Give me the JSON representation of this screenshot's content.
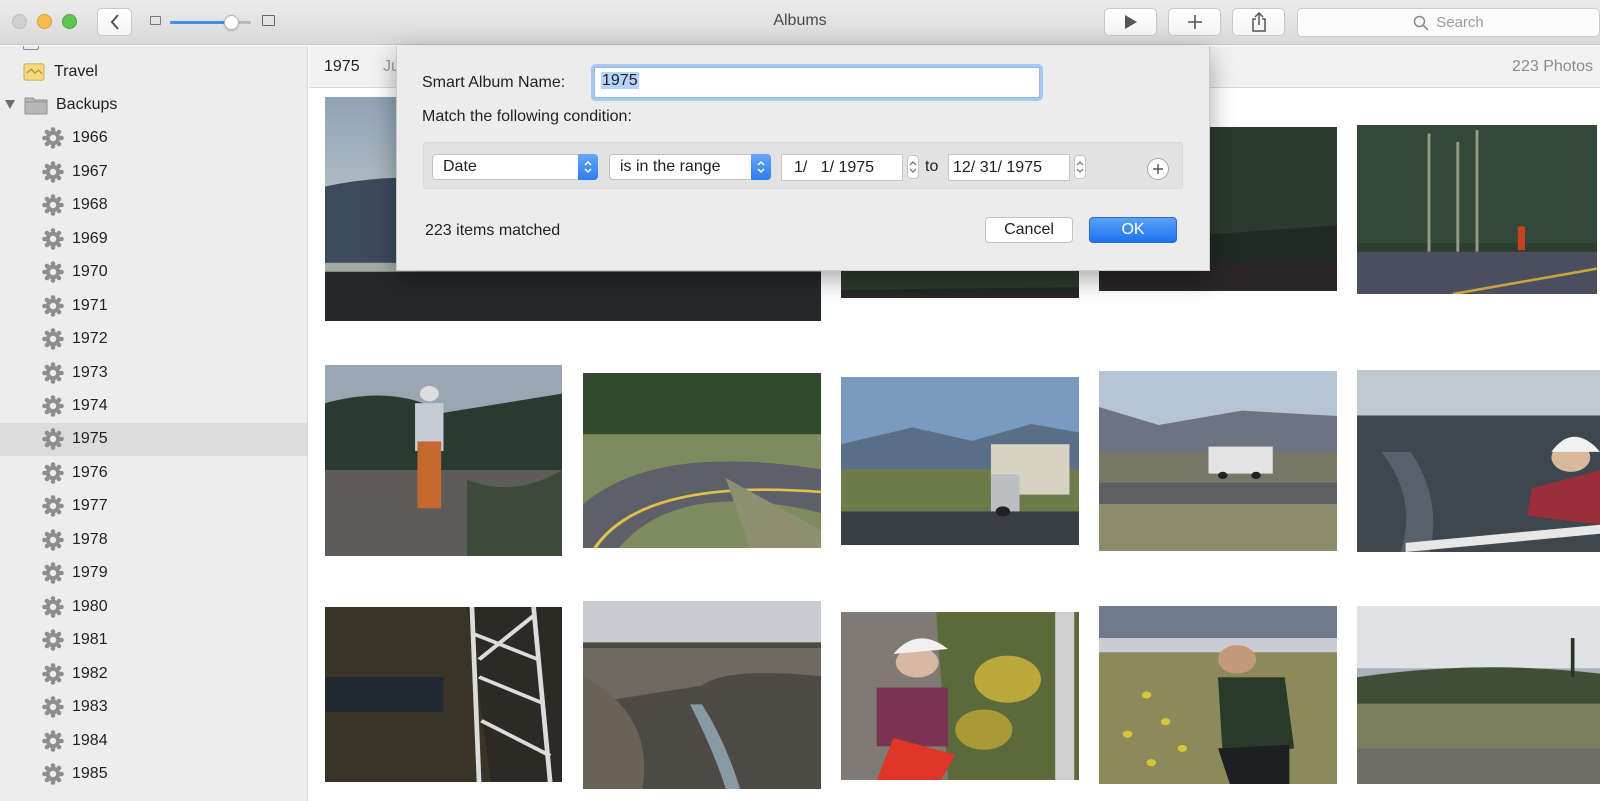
{
  "window": {
    "title": "Albums"
  },
  "toolbar": {
    "search_placeholder": "Search",
    "zoom_level": 0.75
  },
  "sidebar": {
    "items": [
      {
        "label": "Travel",
        "type": "album"
      },
      {
        "label": "Backups",
        "type": "folder"
      },
      {
        "label": "1966",
        "type": "smart"
      },
      {
        "label": "1967",
        "type": "smart"
      },
      {
        "label": "1968",
        "type": "smart"
      },
      {
        "label": "1969",
        "type": "smart"
      },
      {
        "label": "1970",
        "type": "smart"
      },
      {
        "label": "1971",
        "type": "smart"
      },
      {
        "label": "1972",
        "type": "smart"
      },
      {
        "label": "1973",
        "type": "smart"
      },
      {
        "label": "1974",
        "type": "smart"
      },
      {
        "label": "1975",
        "type": "smart",
        "selected": true
      },
      {
        "label": "1976",
        "type": "smart"
      },
      {
        "label": "1977",
        "type": "smart"
      },
      {
        "label": "1978",
        "type": "smart"
      },
      {
        "label": "1979",
        "type": "smart"
      },
      {
        "label": "1980",
        "type": "smart"
      },
      {
        "label": "1981",
        "type": "smart"
      },
      {
        "label": "1982",
        "type": "smart"
      },
      {
        "label": "1983",
        "type": "smart"
      },
      {
        "label": "1984",
        "type": "smart"
      },
      {
        "label": "1985",
        "type": "smart"
      }
    ]
  },
  "content": {
    "title": "1975",
    "subtitle": "Ju",
    "count": "223 Photos"
  },
  "photos": [
    {
      "scene": "mountain-sunset"
    },
    {
      "scene": "dark-forest"
    },
    {
      "scene": "dark-forest"
    },
    {
      "scene": "forest-road"
    },
    {
      "scene": "woman-roadside"
    },
    {
      "scene": "curving-road"
    },
    {
      "scene": "camper-field"
    },
    {
      "scene": "camper-road"
    },
    {
      "scene": "gorge-woman"
    },
    {
      "scene": "bridge-gorge"
    },
    {
      "scene": "canyon-river"
    },
    {
      "scene": "woman-flowers"
    },
    {
      "scene": "man-flowers"
    },
    {
      "scene": "sagebrush-plain"
    }
  ],
  "dialog": {
    "name_label": "Smart Album Name:",
    "name_value": "1975",
    "condition_label": "Match the following condition:",
    "field": "Date",
    "operator": "is in the range",
    "start_date": "1/   1/ 1975",
    "to_label": "to",
    "end_date": "12/ 31/ 1975",
    "matched": "223 items matched",
    "cancel_label": "Cancel",
    "ok_label": "OK"
  },
  "colors": {
    "accent": "#2d7cf0",
    "selection": "#b5d3fb"
  }
}
